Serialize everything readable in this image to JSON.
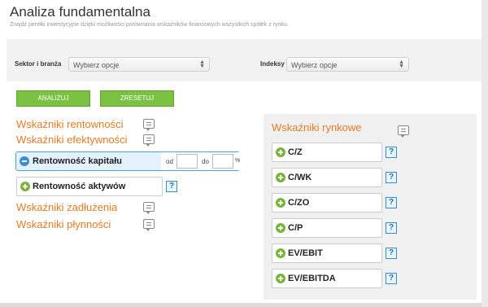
{
  "header": {
    "title": "Analiza fundamentalna",
    "subtitle": "Znajdź perełki inwestycyjne dzięki możliwości porównania wskaźników finansowych wszystkich spółek z rynku."
  },
  "filters": {
    "sector_label": "Sektor i branża",
    "sector_value": "Wybierz opcje",
    "index_label": "Indeksy",
    "index_value": "Wybierz opcje"
  },
  "buttons": {
    "analyze": "ANALIZUJ",
    "reset": "ZRESETUJ"
  },
  "left_groups": {
    "profitability": "Wskaźniki rentowności",
    "efficiency": "Wskaźniki efektywności",
    "debt": "Wskaźniki zadłużenia",
    "liquidity": "Wskaźniki płynności"
  },
  "active_indicator": {
    "label": "Rentowność kapitału",
    "from_label": "od",
    "from_value": "",
    "to_label": "do",
    "to_value": "",
    "unit": "%"
  },
  "secondary_indicator": {
    "label": "Rentowność aktywów"
  },
  "market_panel": {
    "title": "Wskaźniki rynkowe",
    "items": [
      {
        "label": "C/Z"
      },
      {
        "label": "C/WK"
      },
      {
        "label": "C/ZO"
      },
      {
        "label": "C/P"
      },
      {
        "label": "EV/EBIT"
      },
      {
        "label": "EV/EBITDA"
      }
    ]
  },
  "help_symbol": "?",
  "colors": {
    "accent_orange": "#e57b27",
    "button_green": "#7cc242",
    "active_blue": "#4aa3d8"
  }
}
